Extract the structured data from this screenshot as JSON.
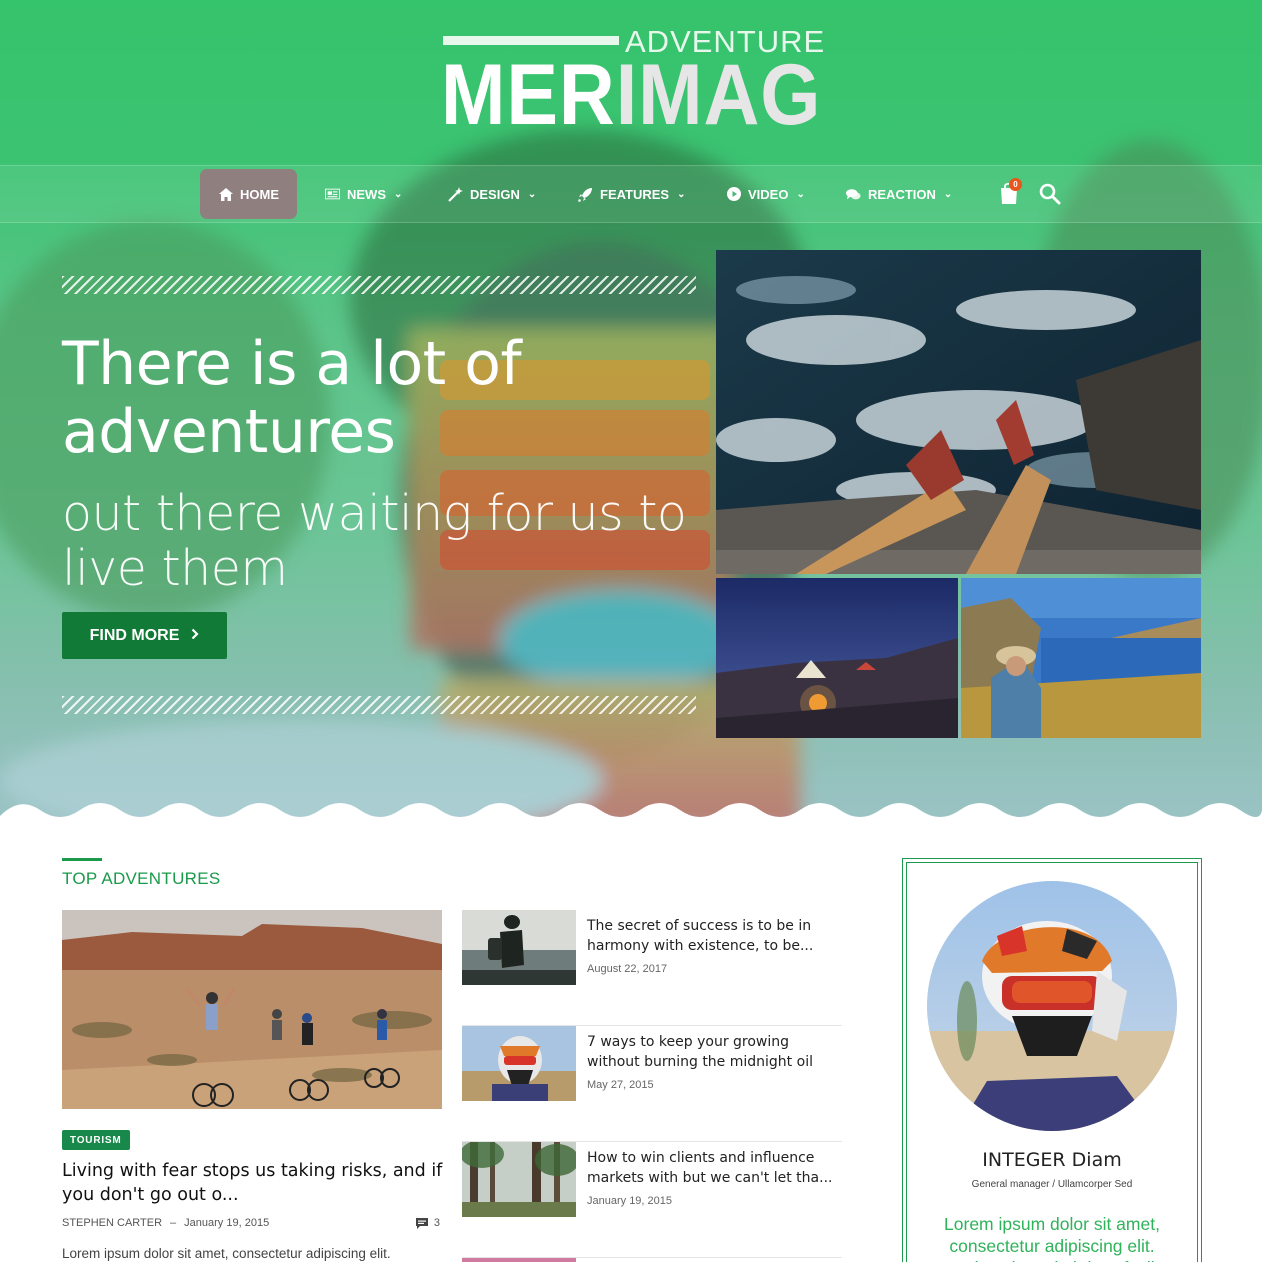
{
  "brand": {
    "logo_small": "ADVENTURE",
    "logo_main_white": "MER",
    "logo_main_grey": "IMAG"
  },
  "nav": {
    "items": [
      {
        "label": "HOME",
        "icon": "home-icon"
      },
      {
        "label": "NEWS",
        "icon": "newspaper-icon"
      },
      {
        "label": "DESIGN",
        "icon": "magic-wand-icon"
      },
      {
        "label": "FEATURES",
        "icon": "rocket-icon"
      },
      {
        "label": "VIDEO",
        "icon": "play-circle-icon"
      },
      {
        "label": "REACTION",
        "icon": "chat-icon"
      }
    ],
    "cart_count": "0"
  },
  "hero": {
    "title": "There is a lot of adventures",
    "subtitle": "out there waiting for us to live them",
    "button_label": "FIND MORE"
  },
  "section": {
    "title": "TOP ADVENTURES"
  },
  "featured": {
    "tag": "TOURISM",
    "title": "Living with fear stops us taking risks, and if you don't go out o...",
    "author": "STEPHEN CARTER",
    "separator": "–",
    "date": "January 19, 2015",
    "comments": "3",
    "excerpt": "Lorem ipsum dolor sit amet, consectetur adipiscing elit."
  },
  "posts": [
    {
      "title": "The secret of success is to be in harmony with existence, to be...",
      "date": "August 22, 2017"
    },
    {
      "title": "7 ways to keep your growing without burning the midnight oil",
      "date": "May 27, 2015"
    },
    {
      "title": "How to win clients and influence markets with but we can't let tha...",
      "date": "January 19, 2015"
    }
  ],
  "profile": {
    "name": "INTEGER Diam",
    "role": "General manager / Ullamcorper Sed",
    "description": "Lorem ipsum dolor sit amet, consectetur adipiscing elit. Mauris euismod ultrices facil..."
  },
  "colors": {
    "brand_green": "#35c36b",
    "button_green": "#107a36",
    "accent_green": "#1a9a4a",
    "nav_active": "#8f7f7f",
    "cart_badge": "#e8561c"
  }
}
